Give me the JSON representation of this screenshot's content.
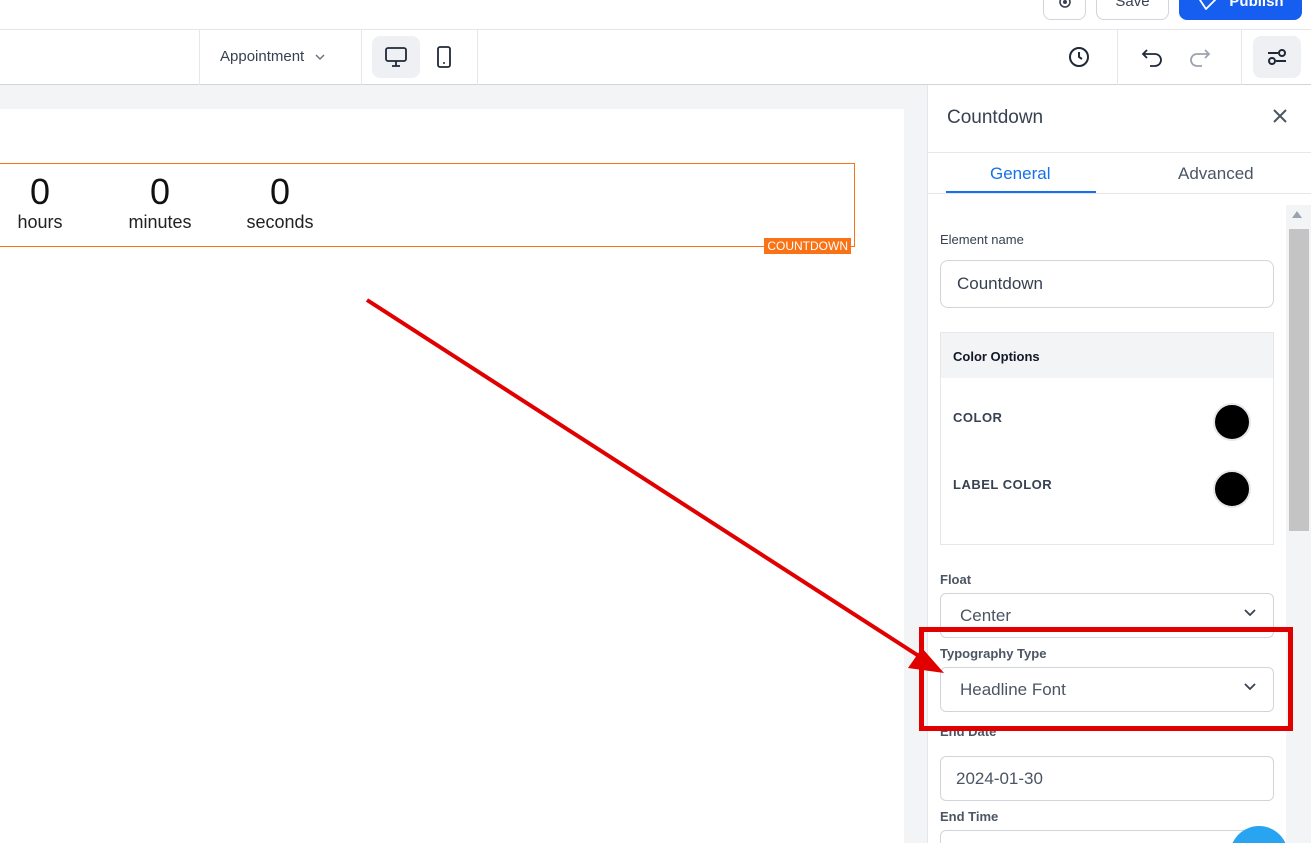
{
  "top_actions": {
    "preview_label": "",
    "save_label": "Save",
    "publish_label": "Publish"
  },
  "toolbar": {
    "page_select": "Appointment",
    "devices": [
      "desktop-icon",
      "mobile-icon"
    ],
    "history_icon": "history-icon",
    "undo_icon": "undo-icon",
    "redo_icon": "redo-icon",
    "settings_icon": "sliders-icon"
  },
  "canvas": {
    "countdown": {
      "units": [
        {
          "value": "0",
          "label": "hours"
        },
        {
          "value": "0",
          "label": "minutes"
        },
        {
          "value": "0",
          "label": "seconds"
        }
      ],
      "tag": "COUNTDOWN",
      "border_color": "#f97316"
    }
  },
  "panel": {
    "title": "Countdown",
    "tabs": [
      {
        "label": "General",
        "active": true
      },
      {
        "label": "Advanced",
        "active": false
      }
    ],
    "element_name": {
      "label": "Element name",
      "value": "Countdown"
    },
    "color_options": {
      "title": "Color Options",
      "items": [
        {
          "label": "COLOR",
          "color": "#000000"
        },
        {
          "label": "LABEL COLOR",
          "color": "#000000"
        }
      ]
    },
    "float": {
      "label": "Float",
      "value": "Center"
    },
    "typography": {
      "label": "Typography Type",
      "value": "Headline Font"
    },
    "end_date": {
      "label": "End Date",
      "value": "2024-01-30"
    },
    "end_time": {
      "label": "End Time"
    }
  },
  "colors": {
    "accent": "#1570ef",
    "publish": "#155eef",
    "annotation": "#e00000"
  }
}
